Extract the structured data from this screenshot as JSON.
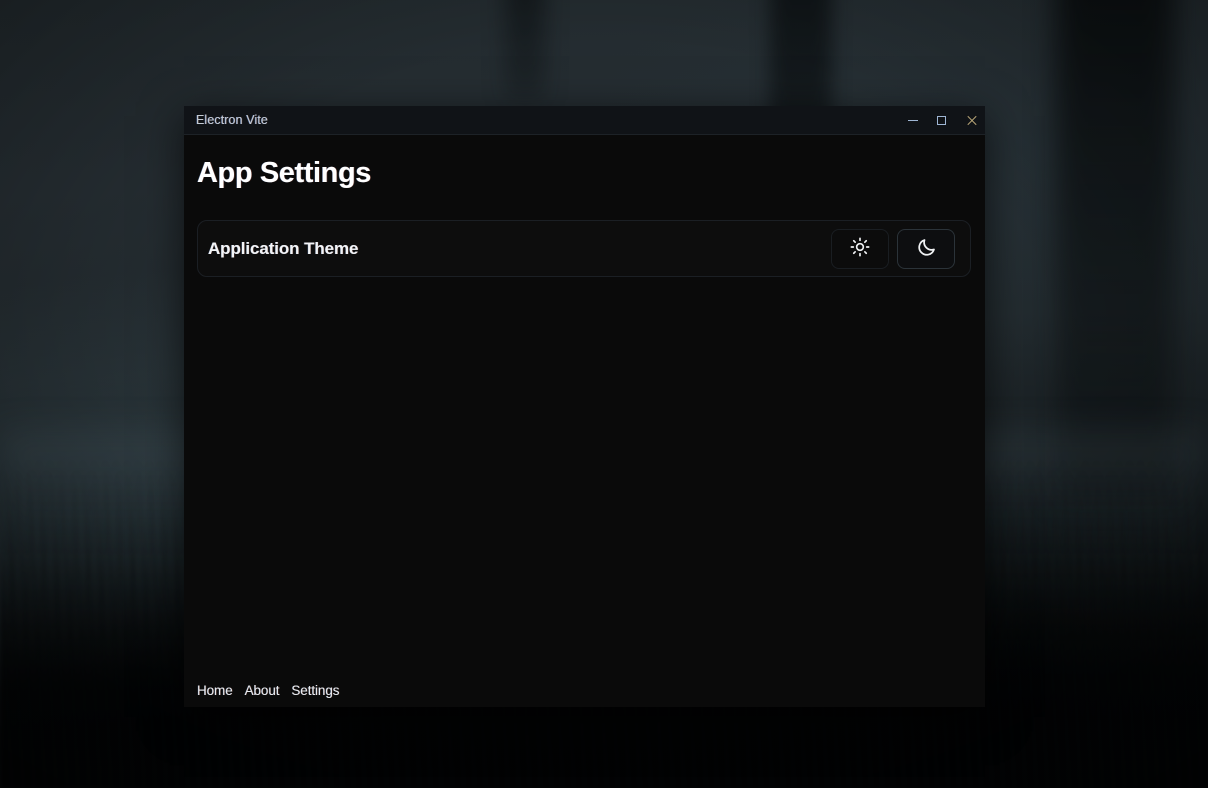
{
  "window": {
    "title": "Electron Vite",
    "controls": [
      {
        "name": "minimize",
        "icon": "minimize-icon",
        "label": "Minimize"
      },
      {
        "name": "maximize",
        "icon": "maximize-icon",
        "label": "Maximize"
      },
      {
        "name": "close",
        "icon": "close-icon",
        "label": "Close"
      }
    ]
  },
  "page": {
    "title": "App Settings"
  },
  "settings": {
    "theme_row": {
      "label": "Application Theme",
      "options": [
        {
          "value": "light",
          "icon": "sun-icon",
          "label": "Light",
          "selected": false
        },
        {
          "value": "dark",
          "icon": "moon-icon",
          "label": "Dark",
          "selected": true
        }
      ]
    }
  },
  "nav": {
    "items": [
      {
        "label": "Home",
        "href": "#home"
      },
      {
        "label": "About",
        "href": "#about"
      },
      {
        "label": "Settings",
        "href": "#settings"
      }
    ]
  },
  "colors": {
    "window_bg": "#0a0a0a",
    "titlebar_bg": "#101317",
    "card_bg": "#0d0d0d",
    "card_border": "#1b1f24",
    "text_primary": "#ffffff",
    "text_muted": "#c3cbd4",
    "active_border": "#2b3339",
    "desktop_bg": "#232b2f"
  }
}
